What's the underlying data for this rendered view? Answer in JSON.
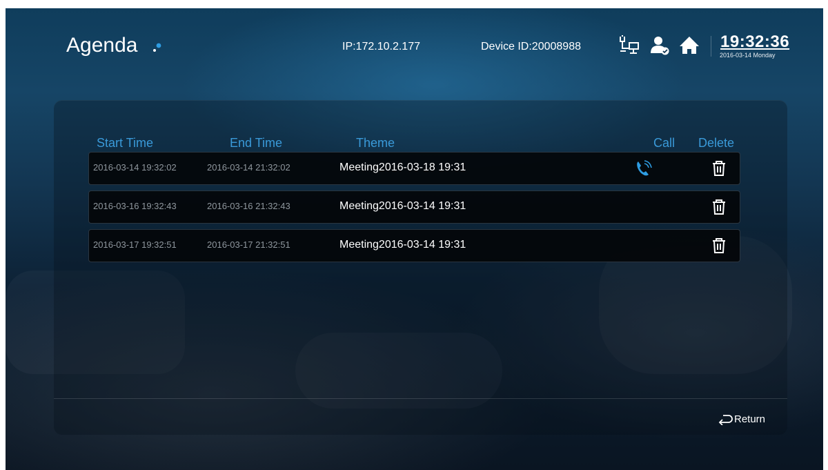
{
  "header": {
    "title": "Agenda",
    "ip": "IP:172.10.2.177",
    "device_id": "Device ID:20008988",
    "time": "19:32:36",
    "date": "2016-03-14 Monday",
    "icons": [
      "network-icon",
      "user-status-icon",
      "home-icon"
    ]
  },
  "table": {
    "columns": {
      "start": "Start Time",
      "end": "End Time",
      "theme": "Theme",
      "call": "Call",
      "delete": "Delete"
    },
    "rows": [
      {
        "start": "2016-03-14 19:32:02",
        "end": "2016-03-14 21:32:02",
        "theme": "Meeting2016-03-18 19:31",
        "call_available": true
      },
      {
        "start": "2016-03-16 19:32:43",
        "end": "2016-03-16 21:32:43",
        "theme": "Meeting2016-03-14 19:31",
        "call_available": false
      },
      {
        "start": "2016-03-17 19:32:51",
        "end": "2016-03-17 21:32:51",
        "theme": "Meeting2016-03-14 19:31",
        "call_available": false
      }
    ]
  },
  "footer": {
    "return_label": "Return"
  },
  "colors": {
    "accent": "#3a9ad9",
    "call_icon": "#2e9de3"
  }
}
